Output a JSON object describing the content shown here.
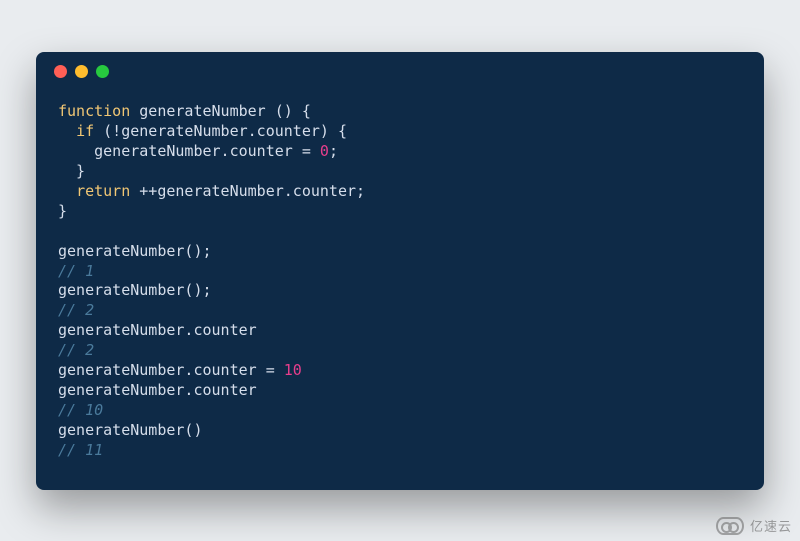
{
  "code": {
    "lines": [
      [
        {
          "t": "function",
          "c": "kw"
        },
        {
          "t": " ",
          "c": "pn"
        },
        {
          "t": "generateNumber",
          "c": "fn"
        },
        {
          "t": " ",
          "c": "pn"
        },
        {
          "t": "() {",
          "c": "pn"
        }
      ],
      [
        {
          "t": "  ",
          "c": "pn"
        },
        {
          "t": "if",
          "c": "kw"
        },
        {
          "t": " (!generateNumber.counter) {",
          "c": "pn"
        }
      ],
      [
        {
          "t": "    generateNumber.counter = ",
          "c": "pn"
        },
        {
          "t": "0",
          "c": "num"
        },
        {
          "t": ";",
          "c": "pn"
        }
      ],
      [
        {
          "t": "  }",
          "c": "pn"
        }
      ],
      [
        {
          "t": "  ",
          "c": "pn"
        },
        {
          "t": "return",
          "c": "kw"
        },
        {
          "t": " ++generateNumber.counter;",
          "c": "pn"
        }
      ],
      [
        {
          "t": "}",
          "c": "pn"
        }
      ],
      [
        {
          "t": "",
          "c": "pn"
        }
      ],
      [
        {
          "t": "generateNumber();",
          "c": "pn"
        }
      ],
      [
        {
          "t": "// 1",
          "c": "cm"
        }
      ],
      [
        {
          "t": "generateNumber();",
          "c": "pn"
        }
      ],
      [
        {
          "t": "// 2",
          "c": "cm"
        }
      ],
      [
        {
          "t": "generateNumber.counter",
          "c": "pn"
        }
      ],
      [
        {
          "t": "// 2",
          "c": "cm"
        }
      ],
      [
        {
          "t": "generateNumber.counter = ",
          "c": "pn"
        },
        {
          "t": "10",
          "c": "num"
        }
      ],
      [
        {
          "t": "generateNumber.counter",
          "c": "pn"
        }
      ],
      [
        {
          "t": "// 10",
          "c": "cm"
        }
      ],
      [
        {
          "t": "generateNumber()",
          "c": "pn"
        }
      ],
      [
        {
          "t": "// 11",
          "c": "cm"
        }
      ]
    ]
  },
  "watermark": {
    "text": "亿速云"
  }
}
